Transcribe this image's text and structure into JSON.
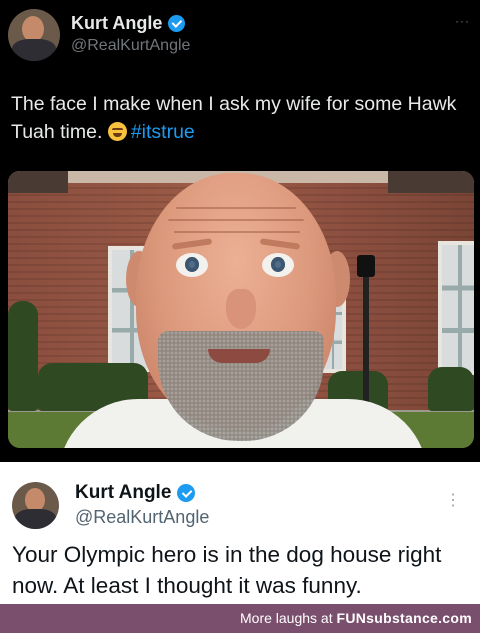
{
  "top_tweet": {
    "author_name": "Kurt Angle",
    "handle": "@RealKurtAngle",
    "more": "···",
    "text": "The face I make when I ask my wife for some Hawk Tuah time.",
    "emoji": "grinning-squinting-face",
    "hashtag": "#itstrue"
  },
  "bottom_tweet": {
    "author_name": "Kurt Angle",
    "handle": "@RealKurtAngle",
    "more": "⋮",
    "text": "Your Olympic hero is in the dog house right now. At least I thought it was funny."
  },
  "footer": {
    "prefix": "More laughs at",
    "brand": "FUNsubstance.com"
  },
  "colors": {
    "verified_blue": "#1d9bf0",
    "hashtag_blue": "#1d9bf0",
    "footer_bg": "#7a4f6d",
    "dark_bg": "#000000"
  }
}
